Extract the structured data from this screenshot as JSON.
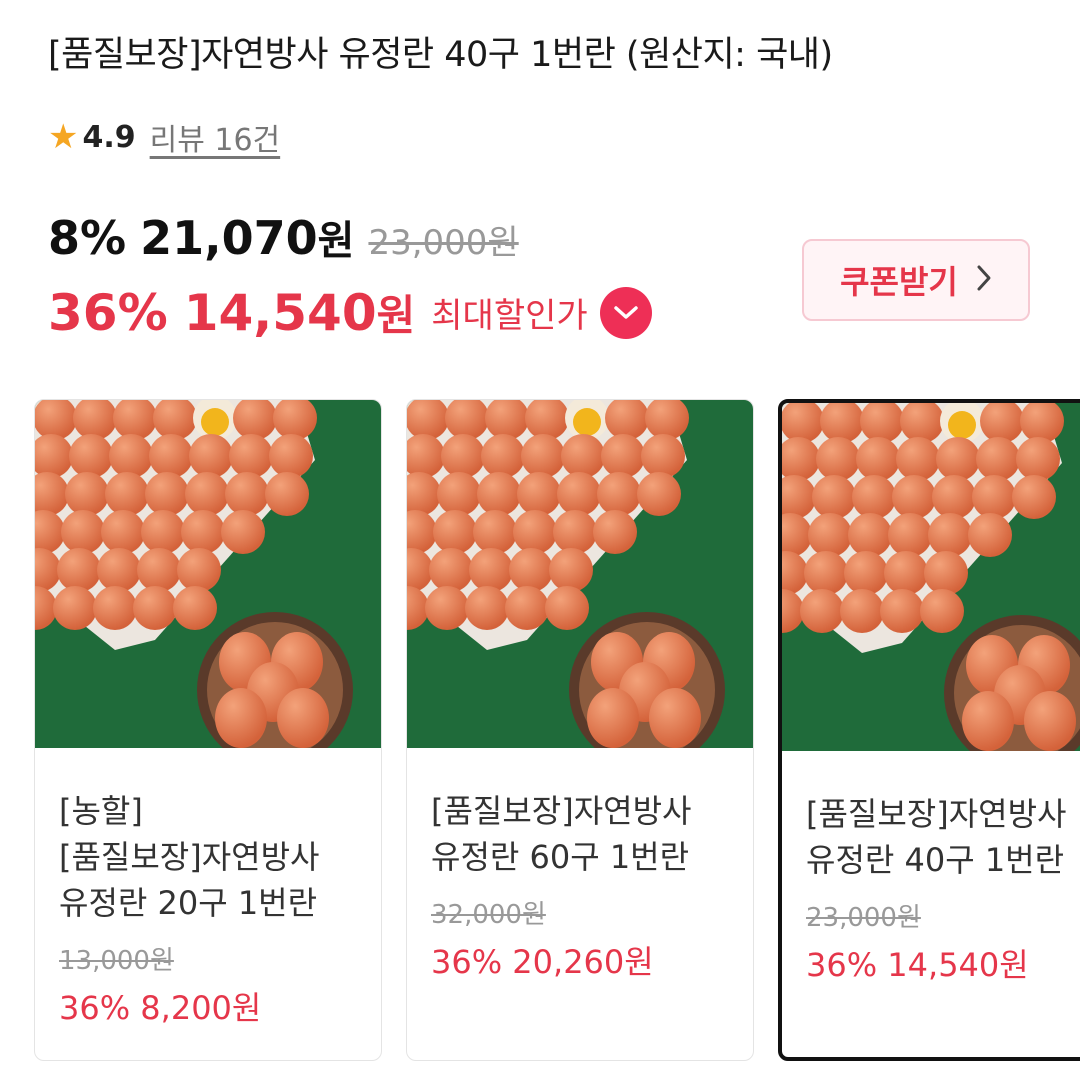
{
  "product": {
    "title": "[품질보장]자연방사 유정란 40구 1번란 (원산지: 국내)",
    "rating": {
      "star_icon": "star-icon",
      "score": "4.9",
      "reviews_label": "리뷰 16건"
    }
  },
  "pricing": {
    "discount_rate": "8%",
    "price": "21,070",
    "currency": "원",
    "original_price": "23,000원",
    "max_discount_rate": "36%",
    "max_price": "14,540",
    "max_label": "최대할인가",
    "dropdown_icon": "chevron-down-circle-icon",
    "accent_color": "#e5364a"
  },
  "coupon": {
    "label": "쿠폰받기",
    "icon": "chevron-right-icon"
  },
  "options": [
    {
      "title_lines": [
        "[농할]",
        "[품질보장]자연방사",
        "유정란 20구 1번란"
      ],
      "original_price": "13,000원",
      "sale": "36% 8,200원",
      "selected": false
    },
    {
      "title_lines": [
        "[품질보장]자연방사",
        "유정란 60구 1번란"
      ],
      "original_price": "32,000원",
      "sale": "36% 20,260원",
      "selected": false
    },
    {
      "title_lines": [
        "[품질보장]자연방사",
        "유정란 40구 1번란"
      ],
      "original_price": "23,000원",
      "sale": "36% 14,540원",
      "selected": true
    }
  ]
}
